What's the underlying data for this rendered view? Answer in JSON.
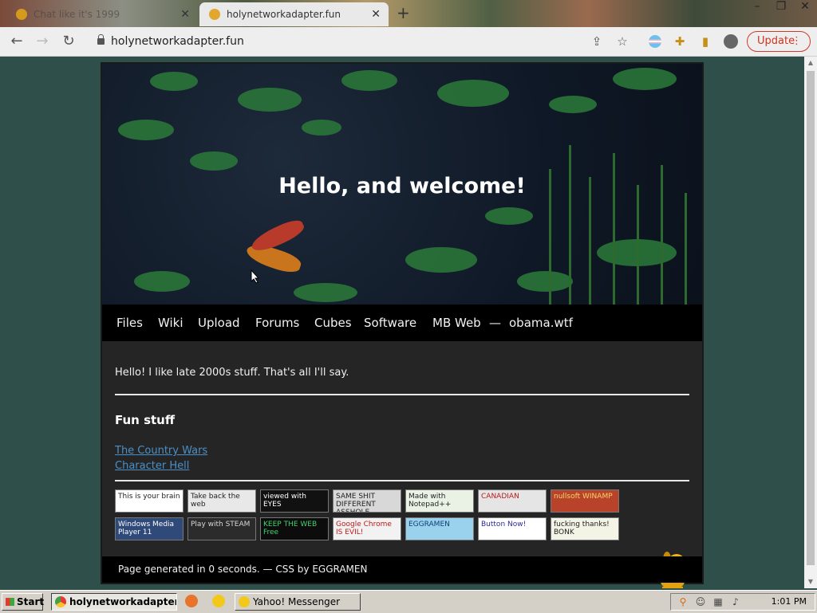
{
  "browser": {
    "tabs": [
      {
        "title": "Chat like it's 1999",
        "active": false
      },
      {
        "title": "holynetworkadapter.fun",
        "active": true
      }
    ],
    "new_tab": "+",
    "url": "holynetworkadapter.fun",
    "update_label": "Update"
  },
  "site": {
    "hero_title": "Hello, and welcome!",
    "nav": [
      "Files",
      "Wiki",
      "Upload",
      "Forums",
      "Cubes",
      "Software",
      "MB Web",
      "—",
      "obama.wtf"
    ],
    "intro": "Hello! I like late 2000s stuff. That's all I'll say.",
    "fun_heading": "Fun stuff",
    "links": [
      "The Country Wars",
      "Character Hell"
    ],
    "badges": [
      {
        "text": "This is your brain",
        "bg": "#ffffff",
        "fg": "#222222"
      },
      {
        "text": "Take back the web",
        "bg": "#e8e8e8",
        "fg": "#222222"
      },
      {
        "text": "viewed with EYES",
        "bg": "#111111",
        "fg": "#ffffff"
      },
      {
        "text": "SAME SHIT DIFFERENT ASSHOLE",
        "bg": "#d8d8d8",
        "fg": "#222222"
      },
      {
        "text": "Made with Notepad++",
        "bg": "#e9f2e4",
        "fg": "#222222"
      },
      {
        "text": "CANADIAN",
        "bg": "#e5e5e5",
        "fg": "#b81c1c"
      },
      {
        "text": "nullsoft WINAMP",
        "bg": "#b8422a",
        "fg": "#f6d66a"
      },
      {
        "text": "Windows Media Player 11",
        "bg": "#2f4a78",
        "fg": "#ffffff"
      },
      {
        "text": "Play with STEAM",
        "bg": "#2b2b2b",
        "fg": "#d8d8d8"
      },
      {
        "text": "KEEP THE WEB Free",
        "bg": "#0c0c0c",
        "fg": "#3fd36b"
      },
      {
        "text": "Google Chrome IS EVIL!",
        "bg": "#f2f2f2",
        "fg": "#c01818"
      },
      {
        "text": "EGGRAMEN",
        "bg": "#9ad2ee",
        "fg": "#0e3f70"
      },
      {
        "text": "Button Now!",
        "bg": "#ffffff",
        "fg": "#2a2a9a"
      },
      {
        "text": "fucking thanks! BONK",
        "bg": "#f3f3e6",
        "fg": "#222222"
      }
    ],
    "footer": "Page generated in 0 seconds. — CSS by EGGRAMEN"
  },
  "taskbar": {
    "start_label": "Start",
    "tasks": [
      "holynetworkadapter.f...",
      "Yahoo! Messenger"
    ],
    "clock": "1:01 PM"
  },
  "colors": {
    "page_bg": "#2e4f4a",
    "accent_update": "#d0321e",
    "link": "#4a90c8"
  }
}
